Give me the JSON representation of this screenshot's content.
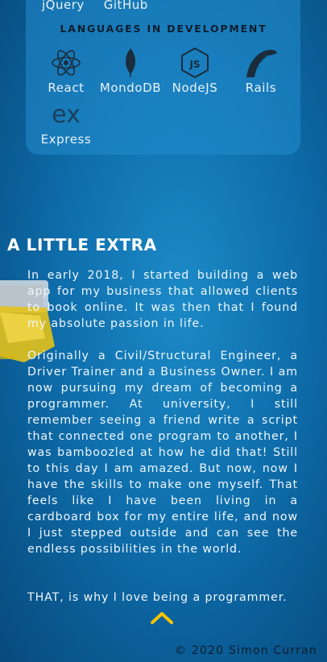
{
  "top_links": [
    "jQuery",
    "GitHub"
  ],
  "languages_heading": "LANGUAGES IN DEVELOPMENT",
  "languages": [
    {
      "label": "React",
      "icon": "react-icon"
    },
    {
      "label": "MondoDB",
      "icon": "mongodb-leaf-icon"
    },
    {
      "label": "NodeJS",
      "icon": "nodejs-icon"
    },
    {
      "label": "Rails",
      "icon": "rails-icon"
    },
    {
      "label": "Express",
      "icon": "express-icon"
    }
  ],
  "extra": {
    "title": "A LITTLE EXTRA",
    "p1": "In early 2018, I started building a web app for my business that allowed clients to book online. It was then that I found my absolute passion in life.",
    "p2": "Originally a Civil/Structural Engineer, a Driver Trainer and a Business Owner. I am now pursuing my dream of becoming a programmer. At university, I still remember seeing a friend write a script that connected one program to another, I was bamboozled at how he did that! Still to this day I am amazed. But now, now I have the skills to make one myself. That feels like I have been living in a cardboard box for my entire life, and now I just stepped outside and can see the endless possibilities in the world.",
    "p3": "THAT, is why I love being a programmer."
  },
  "footer": "© 2020 Simon Curran",
  "colors": {
    "background": "#0f6fad",
    "card": "#228ccd",
    "chevron": "#f5c400",
    "heading_dark": "#0d1d2c"
  }
}
